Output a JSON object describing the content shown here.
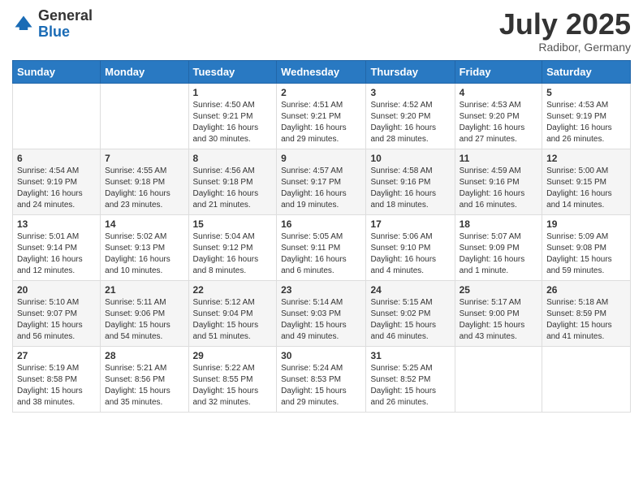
{
  "header": {
    "logo_general": "General",
    "logo_blue": "Blue",
    "month_title": "July 2025",
    "location": "Radibor, Germany"
  },
  "days_of_week": [
    "Sunday",
    "Monday",
    "Tuesday",
    "Wednesday",
    "Thursday",
    "Friday",
    "Saturday"
  ],
  "weeks": [
    [
      {
        "day": null
      },
      {
        "day": null
      },
      {
        "day": "1",
        "sunrise": "Sunrise: 4:50 AM",
        "sunset": "Sunset: 9:21 PM",
        "daylight": "Daylight: 16 hours and 30 minutes."
      },
      {
        "day": "2",
        "sunrise": "Sunrise: 4:51 AM",
        "sunset": "Sunset: 9:21 PM",
        "daylight": "Daylight: 16 hours and 29 minutes."
      },
      {
        "day": "3",
        "sunrise": "Sunrise: 4:52 AM",
        "sunset": "Sunset: 9:20 PM",
        "daylight": "Daylight: 16 hours and 28 minutes."
      },
      {
        "day": "4",
        "sunrise": "Sunrise: 4:53 AM",
        "sunset": "Sunset: 9:20 PM",
        "daylight": "Daylight: 16 hours and 27 minutes."
      },
      {
        "day": "5",
        "sunrise": "Sunrise: 4:53 AM",
        "sunset": "Sunset: 9:19 PM",
        "daylight": "Daylight: 16 hours and 26 minutes."
      }
    ],
    [
      {
        "day": "6",
        "sunrise": "Sunrise: 4:54 AM",
        "sunset": "Sunset: 9:19 PM",
        "daylight": "Daylight: 16 hours and 24 minutes."
      },
      {
        "day": "7",
        "sunrise": "Sunrise: 4:55 AM",
        "sunset": "Sunset: 9:18 PM",
        "daylight": "Daylight: 16 hours and 23 minutes."
      },
      {
        "day": "8",
        "sunrise": "Sunrise: 4:56 AM",
        "sunset": "Sunset: 9:18 PM",
        "daylight": "Daylight: 16 hours and 21 minutes."
      },
      {
        "day": "9",
        "sunrise": "Sunrise: 4:57 AM",
        "sunset": "Sunset: 9:17 PM",
        "daylight": "Daylight: 16 hours and 19 minutes."
      },
      {
        "day": "10",
        "sunrise": "Sunrise: 4:58 AM",
        "sunset": "Sunset: 9:16 PM",
        "daylight": "Daylight: 16 hours and 18 minutes."
      },
      {
        "day": "11",
        "sunrise": "Sunrise: 4:59 AM",
        "sunset": "Sunset: 9:16 PM",
        "daylight": "Daylight: 16 hours and 16 minutes."
      },
      {
        "day": "12",
        "sunrise": "Sunrise: 5:00 AM",
        "sunset": "Sunset: 9:15 PM",
        "daylight": "Daylight: 16 hours and 14 minutes."
      }
    ],
    [
      {
        "day": "13",
        "sunrise": "Sunrise: 5:01 AM",
        "sunset": "Sunset: 9:14 PM",
        "daylight": "Daylight: 16 hours and 12 minutes."
      },
      {
        "day": "14",
        "sunrise": "Sunrise: 5:02 AM",
        "sunset": "Sunset: 9:13 PM",
        "daylight": "Daylight: 16 hours and 10 minutes."
      },
      {
        "day": "15",
        "sunrise": "Sunrise: 5:04 AM",
        "sunset": "Sunset: 9:12 PM",
        "daylight": "Daylight: 16 hours and 8 minutes."
      },
      {
        "day": "16",
        "sunrise": "Sunrise: 5:05 AM",
        "sunset": "Sunset: 9:11 PM",
        "daylight": "Daylight: 16 hours and 6 minutes."
      },
      {
        "day": "17",
        "sunrise": "Sunrise: 5:06 AM",
        "sunset": "Sunset: 9:10 PM",
        "daylight": "Daylight: 16 hours and 4 minutes."
      },
      {
        "day": "18",
        "sunrise": "Sunrise: 5:07 AM",
        "sunset": "Sunset: 9:09 PM",
        "daylight": "Daylight: 16 hours and 1 minute."
      },
      {
        "day": "19",
        "sunrise": "Sunrise: 5:09 AM",
        "sunset": "Sunset: 9:08 PM",
        "daylight": "Daylight: 15 hours and 59 minutes."
      }
    ],
    [
      {
        "day": "20",
        "sunrise": "Sunrise: 5:10 AM",
        "sunset": "Sunset: 9:07 PM",
        "daylight": "Daylight: 15 hours and 56 minutes."
      },
      {
        "day": "21",
        "sunrise": "Sunrise: 5:11 AM",
        "sunset": "Sunset: 9:06 PM",
        "daylight": "Daylight: 15 hours and 54 minutes."
      },
      {
        "day": "22",
        "sunrise": "Sunrise: 5:12 AM",
        "sunset": "Sunset: 9:04 PM",
        "daylight": "Daylight: 15 hours and 51 minutes."
      },
      {
        "day": "23",
        "sunrise": "Sunrise: 5:14 AM",
        "sunset": "Sunset: 9:03 PM",
        "daylight": "Daylight: 15 hours and 49 minutes."
      },
      {
        "day": "24",
        "sunrise": "Sunrise: 5:15 AM",
        "sunset": "Sunset: 9:02 PM",
        "daylight": "Daylight: 15 hours and 46 minutes."
      },
      {
        "day": "25",
        "sunrise": "Sunrise: 5:17 AM",
        "sunset": "Sunset: 9:00 PM",
        "daylight": "Daylight: 15 hours and 43 minutes."
      },
      {
        "day": "26",
        "sunrise": "Sunrise: 5:18 AM",
        "sunset": "Sunset: 8:59 PM",
        "daylight": "Daylight: 15 hours and 41 minutes."
      }
    ],
    [
      {
        "day": "27",
        "sunrise": "Sunrise: 5:19 AM",
        "sunset": "Sunset: 8:58 PM",
        "daylight": "Daylight: 15 hours and 38 minutes."
      },
      {
        "day": "28",
        "sunrise": "Sunrise: 5:21 AM",
        "sunset": "Sunset: 8:56 PM",
        "daylight": "Daylight: 15 hours and 35 minutes."
      },
      {
        "day": "29",
        "sunrise": "Sunrise: 5:22 AM",
        "sunset": "Sunset: 8:55 PM",
        "daylight": "Daylight: 15 hours and 32 minutes."
      },
      {
        "day": "30",
        "sunrise": "Sunrise: 5:24 AM",
        "sunset": "Sunset: 8:53 PM",
        "daylight": "Daylight: 15 hours and 29 minutes."
      },
      {
        "day": "31",
        "sunrise": "Sunrise: 5:25 AM",
        "sunset": "Sunset: 8:52 PM",
        "daylight": "Daylight: 15 hours and 26 minutes."
      },
      {
        "day": null
      },
      {
        "day": null
      }
    ]
  ]
}
